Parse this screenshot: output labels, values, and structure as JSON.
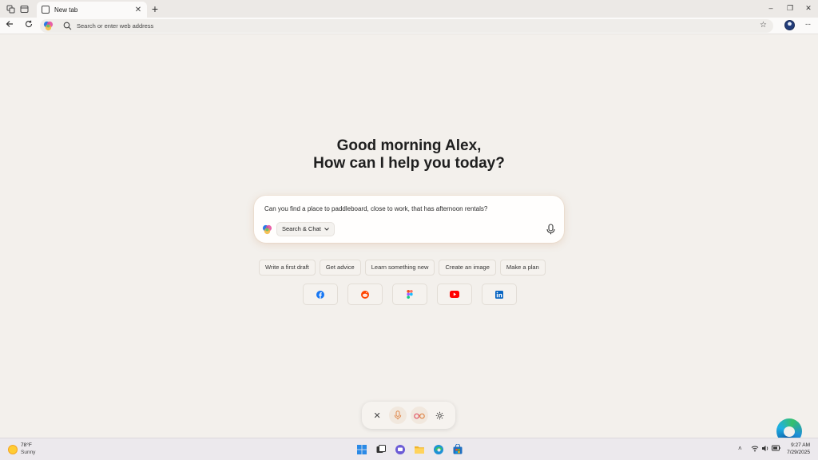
{
  "browser": {
    "tab": {
      "title": "New tab",
      "close": "✕"
    },
    "new_tab": "+",
    "window_controls": {
      "minimize": "–",
      "restore": "❐",
      "close": "✕"
    },
    "address_bar": {
      "placeholder": "Search or enter web address"
    },
    "more_menu": "···"
  },
  "main": {
    "greeting_line1": "Good morning Alex,",
    "greeting_line2": "How can I help you today?",
    "prompt": "Can you find a place to paddleboard, close to work, that has afternoon rentals?",
    "mode_label": "Search & Chat",
    "suggestions": [
      "Write a first draft",
      "Get advice",
      "Learn something new",
      "Create an image",
      "Make a plan"
    ],
    "quick_links": [
      {
        "name": "facebook",
        "color": "#1877f2"
      },
      {
        "name": "reddit",
        "color": "#ff4500"
      },
      {
        "name": "figma",
        "color": "#f24e1e"
      },
      {
        "name": "youtube",
        "color": "#ff0000"
      },
      {
        "name": "linkedin",
        "color": "#0a66c2"
      }
    ]
  },
  "voice_bar": {
    "close": "✕"
  },
  "taskbar": {
    "weather_temp": "78°F",
    "weather_condition": "Sunny",
    "time": "9:27 AM",
    "date": "7/29/2025"
  },
  "colors": {
    "accent": "#2b6dd6",
    "page_bg": "#f3f0ec"
  }
}
